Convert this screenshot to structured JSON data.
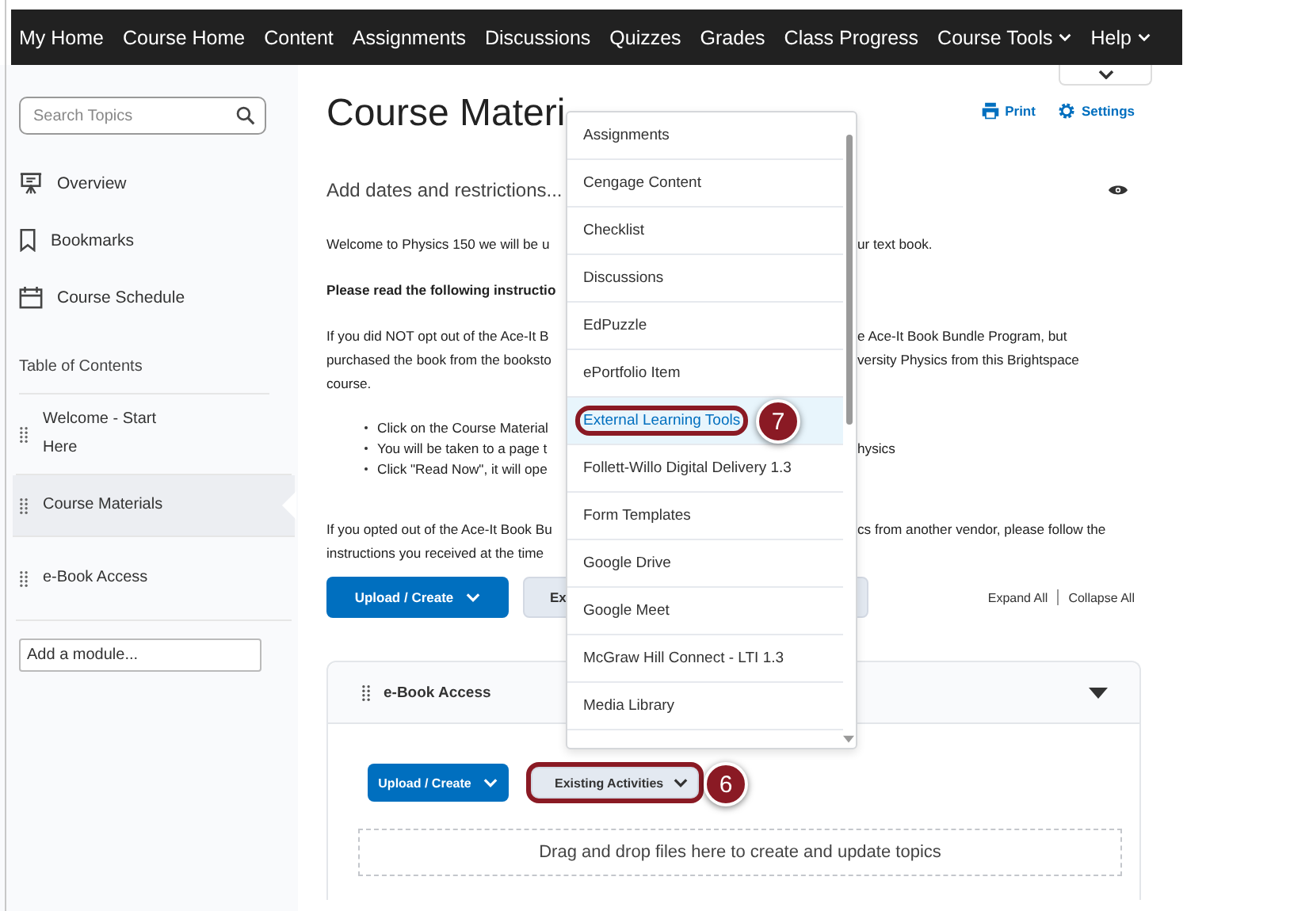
{
  "navbar": {
    "items": [
      {
        "label": "My Home",
        "dropdown": false
      },
      {
        "label": "Course Home",
        "dropdown": false
      },
      {
        "label": "Content",
        "dropdown": false
      },
      {
        "label": "Assignments",
        "dropdown": false
      },
      {
        "label": "Discussions",
        "dropdown": false
      },
      {
        "label": "Quizzes",
        "dropdown": false
      },
      {
        "label": "Grades",
        "dropdown": false
      },
      {
        "label": "Class Progress",
        "dropdown": false
      },
      {
        "label": "Course Tools",
        "dropdown": true
      },
      {
        "label": "Help",
        "dropdown": true
      }
    ]
  },
  "sidebar": {
    "search": {
      "placeholder": "Search Topics"
    },
    "items": [
      {
        "label": "Overview",
        "kind": "overview"
      },
      {
        "label": "Bookmarks",
        "kind": "bookmarks"
      },
      {
        "label": "Course Schedule",
        "kind": "schedule"
      }
    ],
    "toc_heading": "Table of Contents",
    "toc": [
      {
        "label": "Welcome - Start Here",
        "selected": false
      },
      {
        "label": "Course Materials",
        "selected": true
      },
      {
        "label": "e-Book Access",
        "selected": false
      }
    ],
    "add_module": {
      "placeholder": "Add a module..."
    }
  },
  "main": {
    "title": "Course Materi",
    "print": "Print",
    "settings": "Settings",
    "dates_link": "Add dates and restrictions...",
    "lines": [
      {
        "kind": "text",
        "left": "Welcome to Physics 150 we will be u",
        "right": "ur text book."
      },
      {
        "kind": "bold",
        "left": "Please read the following instructio"
      },
      {
        "kind": "text",
        "left": "If you did NOT opt out of the Ace-It B",
        "right": "e Ace-It Book Bundle Program, but"
      },
      {
        "kind": "text",
        "left": "purchased the book from the booksto",
        "right": "versity Physics from this Brightspace"
      },
      {
        "kind": "text",
        "left": "course."
      },
      {
        "kind": "bullet",
        "left": "Click on the Course Material"
      },
      {
        "kind": "bullet",
        "left": "You will be taken to a page t",
        "right": "hysics"
      },
      {
        "kind": "bullet",
        "left": "Click \"Read Now\", it will ope"
      },
      {
        "kind": "text",
        "left": "If you opted out of the Ace-It Book Bu",
        "right": "cs from another vendor, please follow the"
      },
      {
        "kind": "text",
        "left": "instructions you received at the time"
      }
    ],
    "upload_button": "Upload / Create",
    "existing_button": "Ex",
    "expand_all": "Expand All",
    "collapse_all": "Collapse All",
    "module": {
      "title": "e-Book Access",
      "upload_button": "Upload / Create",
      "existing_button": {
        "label": "Existing Activities",
        "callout": "6"
      },
      "drop_zone": "Drag and drop files here to create and update topics"
    }
  },
  "menu": {
    "items": [
      {
        "label": "Assignments",
        "selected": false
      },
      {
        "label": "Cengage Content",
        "selected": false
      },
      {
        "label": "Checklist",
        "selected": false
      },
      {
        "label": "Discussions",
        "selected": false
      },
      {
        "label": "EdPuzzle",
        "selected": false
      },
      {
        "label": "ePortfolio Item",
        "selected": false
      },
      {
        "label": "External Learning Tools",
        "selected": true,
        "callout": "7"
      },
      {
        "label": "Follett-Willo Digital Delivery 1.3",
        "selected": false
      },
      {
        "label": "Form Templates",
        "selected": false
      },
      {
        "label": "Google Drive",
        "selected": false
      },
      {
        "label": "Google Meet",
        "selected": false
      },
      {
        "label": "McGraw Hill Connect - LTI 1.3",
        "selected": false
      },
      {
        "label": "Media Library",
        "selected": false
      }
    ]
  }
}
